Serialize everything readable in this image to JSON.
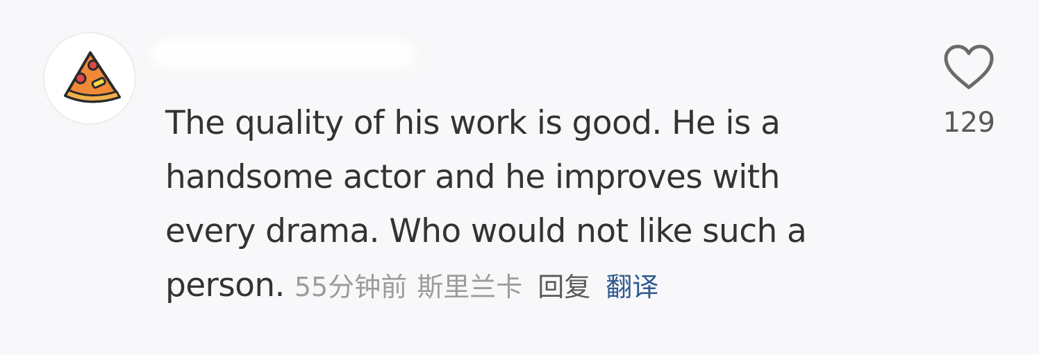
{
  "comment": {
    "avatar_icon": "pizza-slice-icon",
    "text": "The quality of his work is good. He is a handsome actor and he improves with every drama. Who would not like such a person.",
    "time": "55分钟前",
    "location": "斯里兰卡",
    "reply_label": "回复",
    "translate_label": "翻译",
    "like_icon": "heart-outline-icon",
    "like_count": "129"
  },
  "colors": {
    "background": "#f8f8fa",
    "text": "#333333",
    "meta": "#9b9b9b",
    "translate_link": "#2f5a8f",
    "pizza_crust": "#e8a040",
    "pizza_sauce": "#f08a3a",
    "pepperoni": "#e04848",
    "cheese": "#f6d84a"
  }
}
